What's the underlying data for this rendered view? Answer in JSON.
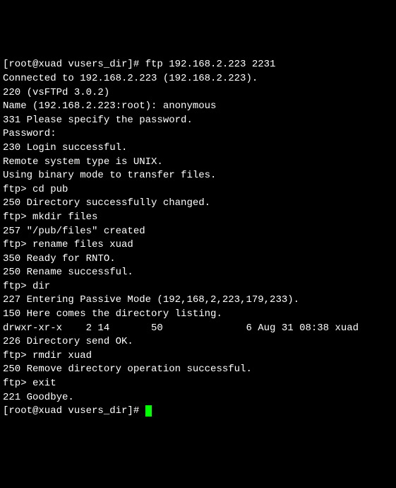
{
  "lines": [
    "[root@xuad vusers_dir]# ftp 192.168.2.223 2231",
    "Connected to 192.168.2.223 (192.168.2.223).",
    "220 (vsFTPd 3.0.2)",
    "Name (192.168.2.223:root): anonymous",
    "331 Please specify the password.",
    "Password:",
    "230 Login successful.",
    "Remote system type is UNIX.",
    "Using binary mode to transfer files.",
    "ftp> cd pub",
    "250 Directory successfully changed.",
    "ftp> mkdir files",
    "257 \"/pub/files\" created",
    "ftp> rename files xuad",
    "350 Ready for RNTO.",
    "250 Rename successful.",
    "ftp> dir",
    "227 Entering Passive Mode (192,168,2,223,179,233).",
    "150 Here comes the directory listing.",
    "drwxr-xr-x    2 14       50              6 Aug 31 08:38 xuad",
    "226 Directory send OK.",
    "ftp> rmdir xuad",
    "250 Remove directory operation successful.",
    "ftp> exit",
    "221 Goodbye.",
    "[root@xuad vusers_dir]# "
  ]
}
